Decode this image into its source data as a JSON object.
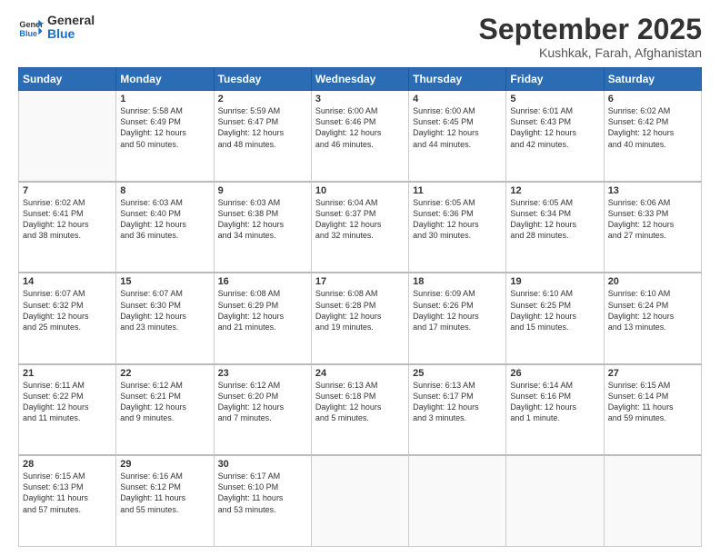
{
  "header": {
    "logo_general": "General",
    "logo_blue": "Blue",
    "month": "September 2025",
    "location": "Kushkak, Farah, Afghanistan"
  },
  "weekdays": [
    "Sunday",
    "Monday",
    "Tuesday",
    "Wednesday",
    "Thursday",
    "Friday",
    "Saturday"
  ],
  "weeks": [
    [
      {
        "day": "",
        "info": ""
      },
      {
        "day": "1",
        "info": "Sunrise: 5:58 AM\nSunset: 6:49 PM\nDaylight: 12 hours\nand 50 minutes."
      },
      {
        "day": "2",
        "info": "Sunrise: 5:59 AM\nSunset: 6:47 PM\nDaylight: 12 hours\nand 48 minutes."
      },
      {
        "day": "3",
        "info": "Sunrise: 6:00 AM\nSunset: 6:46 PM\nDaylight: 12 hours\nand 46 minutes."
      },
      {
        "day": "4",
        "info": "Sunrise: 6:00 AM\nSunset: 6:45 PM\nDaylight: 12 hours\nand 44 minutes."
      },
      {
        "day": "5",
        "info": "Sunrise: 6:01 AM\nSunset: 6:43 PM\nDaylight: 12 hours\nand 42 minutes."
      },
      {
        "day": "6",
        "info": "Sunrise: 6:02 AM\nSunset: 6:42 PM\nDaylight: 12 hours\nand 40 minutes."
      }
    ],
    [
      {
        "day": "7",
        "info": "Sunrise: 6:02 AM\nSunset: 6:41 PM\nDaylight: 12 hours\nand 38 minutes."
      },
      {
        "day": "8",
        "info": "Sunrise: 6:03 AM\nSunset: 6:40 PM\nDaylight: 12 hours\nand 36 minutes."
      },
      {
        "day": "9",
        "info": "Sunrise: 6:03 AM\nSunset: 6:38 PM\nDaylight: 12 hours\nand 34 minutes."
      },
      {
        "day": "10",
        "info": "Sunrise: 6:04 AM\nSunset: 6:37 PM\nDaylight: 12 hours\nand 32 minutes."
      },
      {
        "day": "11",
        "info": "Sunrise: 6:05 AM\nSunset: 6:36 PM\nDaylight: 12 hours\nand 30 minutes."
      },
      {
        "day": "12",
        "info": "Sunrise: 6:05 AM\nSunset: 6:34 PM\nDaylight: 12 hours\nand 28 minutes."
      },
      {
        "day": "13",
        "info": "Sunrise: 6:06 AM\nSunset: 6:33 PM\nDaylight: 12 hours\nand 27 minutes."
      }
    ],
    [
      {
        "day": "14",
        "info": "Sunrise: 6:07 AM\nSunset: 6:32 PM\nDaylight: 12 hours\nand 25 minutes."
      },
      {
        "day": "15",
        "info": "Sunrise: 6:07 AM\nSunset: 6:30 PM\nDaylight: 12 hours\nand 23 minutes."
      },
      {
        "day": "16",
        "info": "Sunrise: 6:08 AM\nSunset: 6:29 PM\nDaylight: 12 hours\nand 21 minutes."
      },
      {
        "day": "17",
        "info": "Sunrise: 6:08 AM\nSunset: 6:28 PM\nDaylight: 12 hours\nand 19 minutes."
      },
      {
        "day": "18",
        "info": "Sunrise: 6:09 AM\nSunset: 6:26 PM\nDaylight: 12 hours\nand 17 minutes."
      },
      {
        "day": "19",
        "info": "Sunrise: 6:10 AM\nSunset: 6:25 PM\nDaylight: 12 hours\nand 15 minutes."
      },
      {
        "day": "20",
        "info": "Sunrise: 6:10 AM\nSunset: 6:24 PM\nDaylight: 12 hours\nand 13 minutes."
      }
    ],
    [
      {
        "day": "21",
        "info": "Sunrise: 6:11 AM\nSunset: 6:22 PM\nDaylight: 12 hours\nand 11 minutes."
      },
      {
        "day": "22",
        "info": "Sunrise: 6:12 AM\nSunset: 6:21 PM\nDaylight: 12 hours\nand 9 minutes."
      },
      {
        "day": "23",
        "info": "Sunrise: 6:12 AM\nSunset: 6:20 PM\nDaylight: 12 hours\nand 7 minutes."
      },
      {
        "day": "24",
        "info": "Sunrise: 6:13 AM\nSunset: 6:18 PM\nDaylight: 12 hours\nand 5 minutes."
      },
      {
        "day": "25",
        "info": "Sunrise: 6:13 AM\nSunset: 6:17 PM\nDaylight: 12 hours\nand 3 minutes."
      },
      {
        "day": "26",
        "info": "Sunrise: 6:14 AM\nSunset: 6:16 PM\nDaylight: 12 hours\nand 1 minute."
      },
      {
        "day": "27",
        "info": "Sunrise: 6:15 AM\nSunset: 6:14 PM\nDaylight: 11 hours\nand 59 minutes."
      }
    ],
    [
      {
        "day": "28",
        "info": "Sunrise: 6:15 AM\nSunset: 6:13 PM\nDaylight: 11 hours\nand 57 minutes."
      },
      {
        "day": "29",
        "info": "Sunrise: 6:16 AM\nSunset: 6:12 PM\nDaylight: 11 hours\nand 55 minutes."
      },
      {
        "day": "30",
        "info": "Sunrise: 6:17 AM\nSunset: 6:10 PM\nDaylight: 11 hours\nand 53 minutes."
      },
      {
        "day": "",
        "info": ""
      },
      {
        "day": "",
        "info": ""
      },
      {
        "day": "",
        "info": ""
      },
      {
        "day": "",
        "info": ""
      }
    ]
  ]
}
